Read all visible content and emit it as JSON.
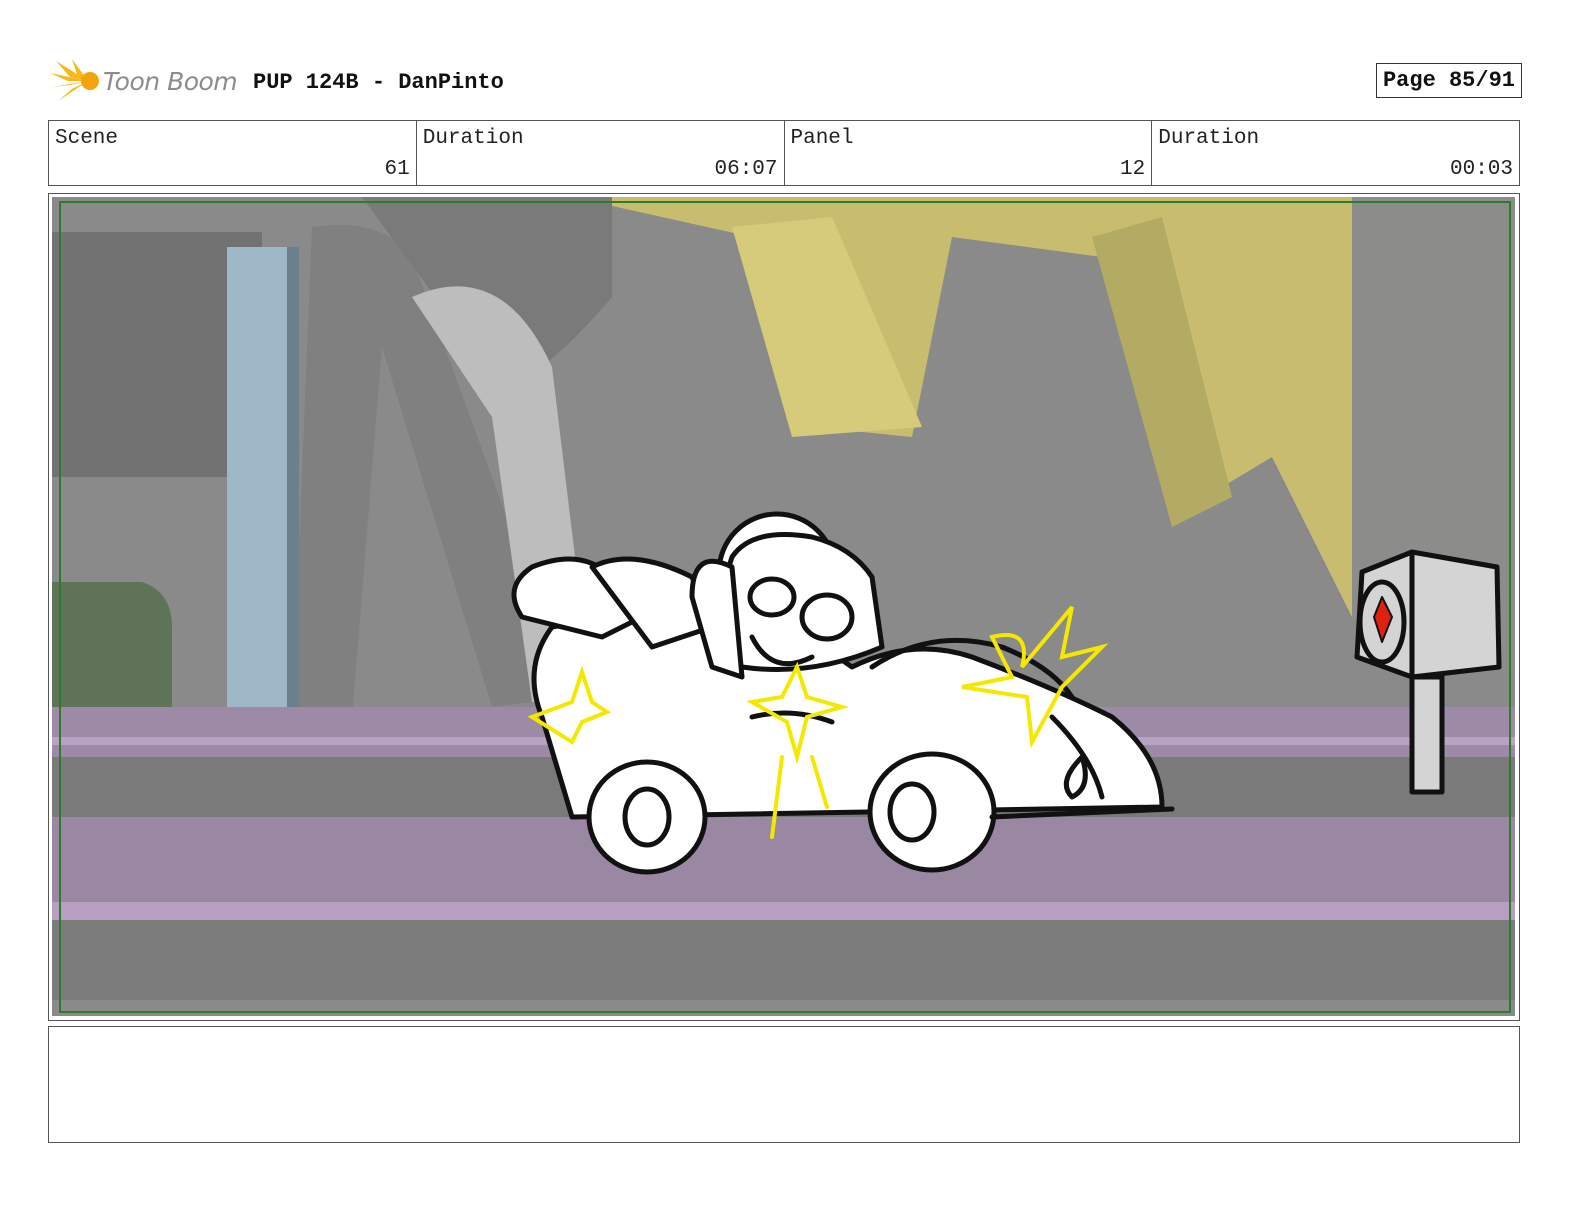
{
  "header": {
    "logo_text": "Toon Boom",
    "title": "PUP 124B - DanPinto",
    "page": "Page 85/91"
  },
  "info": {
    "scene_label": "Scene",
    "scene_value": "61",
    "duration_label": "Duration",
    "duration_value": "06:07",
    "panel_label": "Panel",
    "panel_value": "12",
    "panel_duration_label": "Duration",
    "panel_duration_value": "00:03"
  },
  "notes": {
    "text": ""
  },
  "colors": {
    "safe_frame": "#2f7a2f",
    "sparkle": "#f5e800",
    "background_wall": "#c9bd6e",
    "road_stripe": "#a08aaa"
  }
}
